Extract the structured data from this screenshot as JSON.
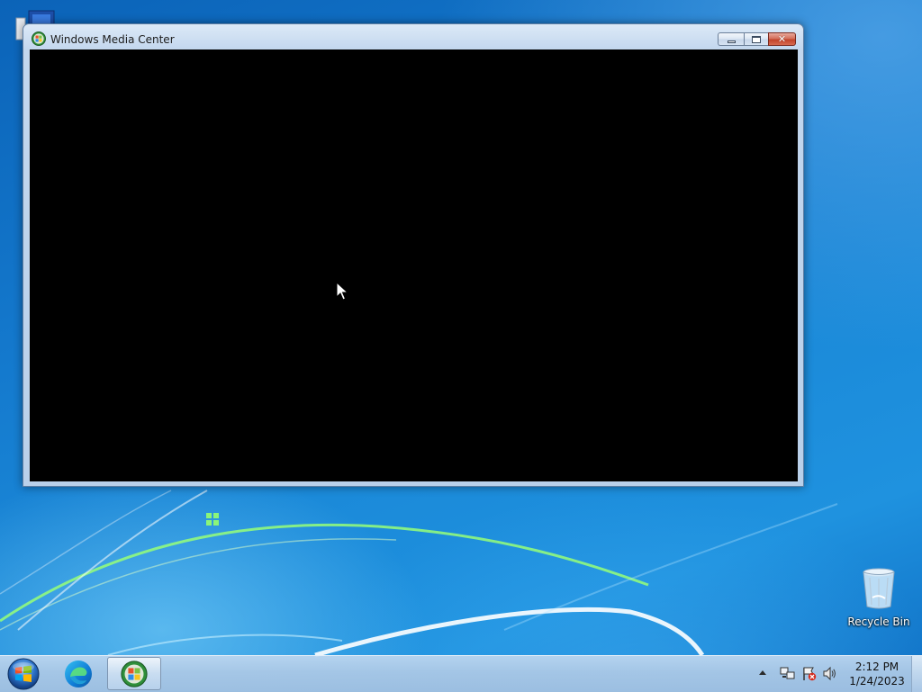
{
  "window": {
    "title": "Windows Media Center",
    "icon": "windows-media-center-icon",
    "buttons": {
      "minimize": "minimize-icon",
      "maximize": "maximize-icon",
      "close": "close-icon"
    }
  },
  "desktop": {
    "icons": [
      {
        "label": "Recycle Bin",
        "icon": "recycle-bin-icon"
      }
    ]
  },
  "taskbar": {
    "start": "windows-start-icon",
    "pinned": [
      {
        "name": "Microsoft Edge",
        "icon": "edge-icon"
      },
      {
        "name": "Windows Media Center",
        "icon": "windows-media-center-icon",
        "active": true
      }
    ],
    "tray": {
      "icons": [
        "show-hidden-icons-arrow",
        "network-icon",
        "action-center-icon",
        "volume-icon"
      ],
      "time": "2:12 PM",
      "date": "1/24/2023"
    }
  },
  "colors": {
    "desktop": "#1a7fd0",
    "window_frame": "#c3d7ee",
    "content": "#000000",
    "close_button": "#c2432b"
  }
}
